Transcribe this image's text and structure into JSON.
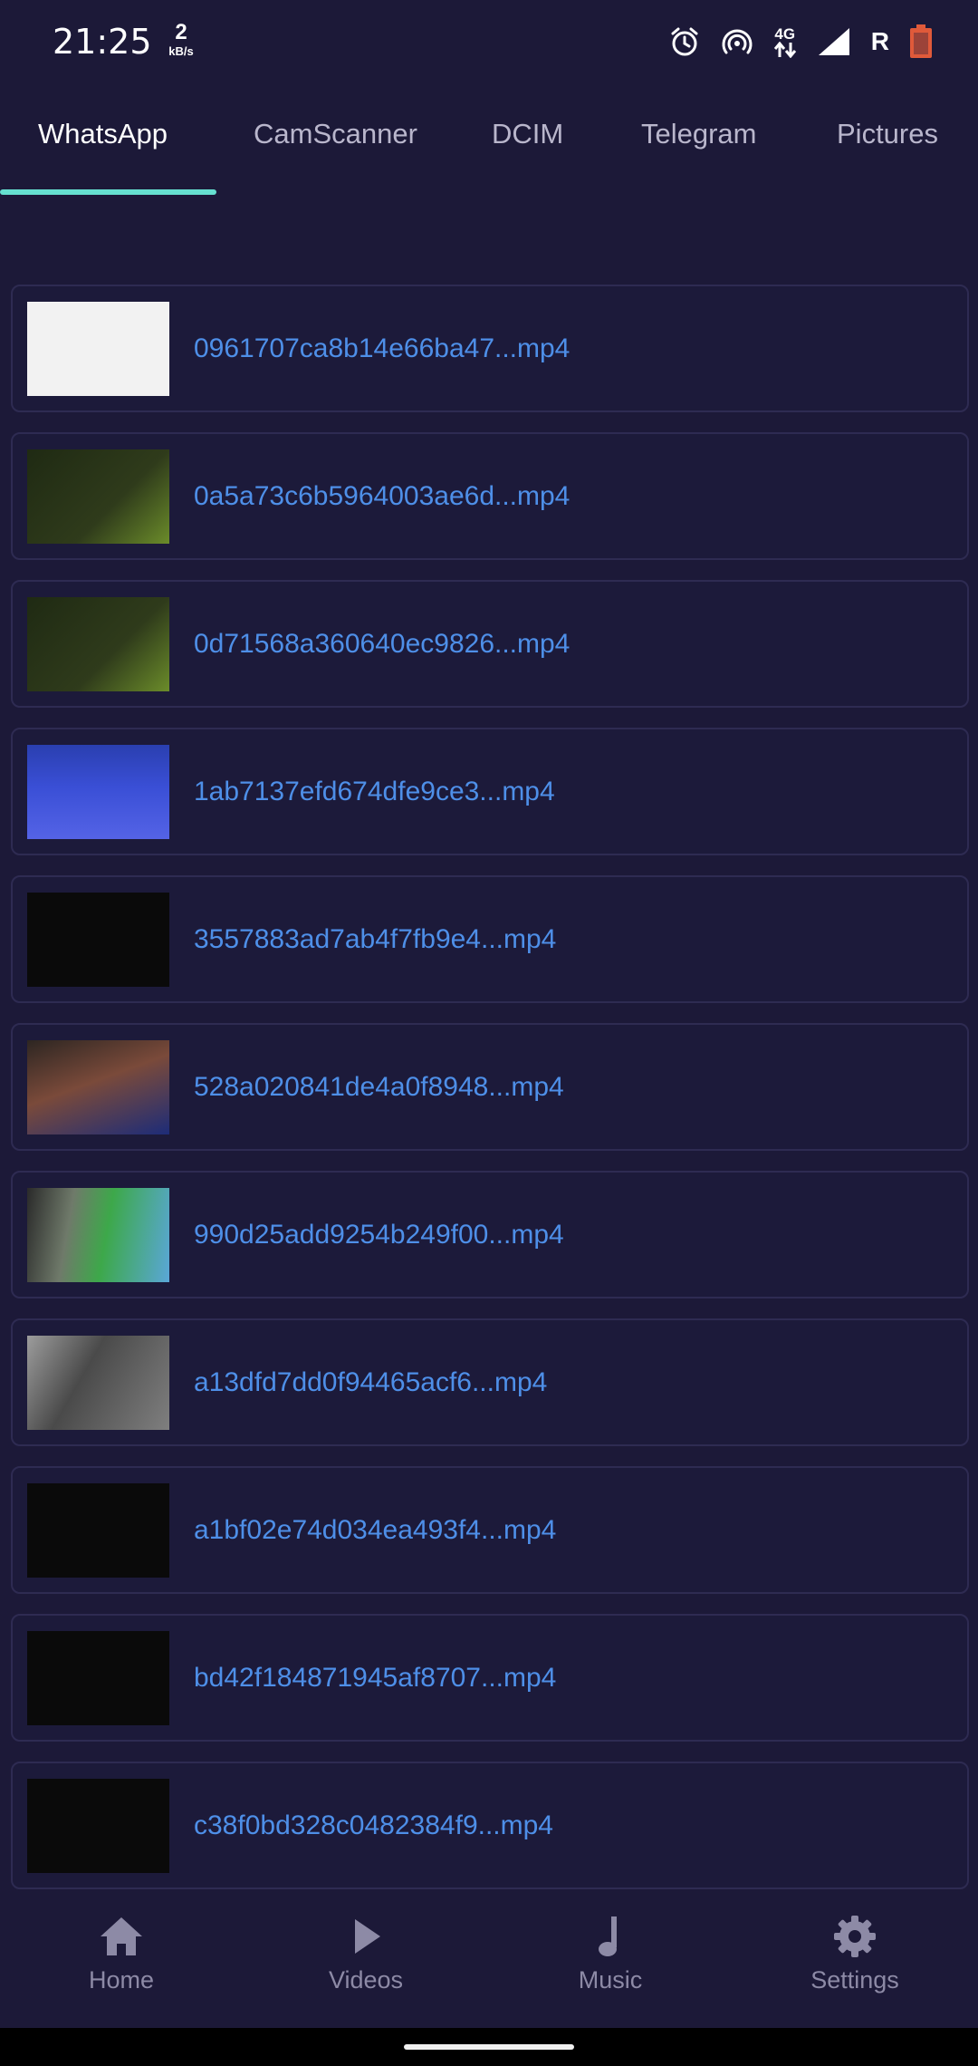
{
  "status_bar": {
    "time": "21:25",
    "net_speed_value": "2",
    "net_speed_unit": "kB/s",
    "network_type": "4G",
    "roaming": "R",
    "battery_level": "41",
    "icons": [
      "alarm-icon",
      "hotspot-icon",
      "data-arrows-icon",
      "signal-icon",
      "battery-icon"
    ]
  },
  "tabs": [
    {
      "label": "WhatsApp",
      "active": true
    },
    {
      "label": "CamScanner",
      "active": false
    },
    {
      "label": "DCIM",
      "active": false
    },
    {
      "label": "Telegram",
      "active": false
    },
    {
      "label": "Pictures",
      "active": false
    }
  ],
  "files": [
    {
      "name": "0961707ca8b14e66ba47...mp4"
    },
    {
      "name": "0a5a73c6b5964003ae6d...mp4"
    },
    {
      "name": "0d71568a360640ec9826...mp4"
    },
    {
      "name": "1ab7137efd674dfe9ce3...mp4"
    },
    {
      "name": "3557883ad7ab4f7fb9e4...mp4"
    },
    {
      "name": "528a020841de4a0f8948...mp4"
    },
    {
      "name": "990d25add9254b249f00...mp4"
    },
    {
      "name": "a13dfd7dd0f94465acf6...mp4"
    },
    {
      "name": "a1bf02e74d034ea493f4...mp4"
    },
    {
      "name": "bd42f184871945af8707...mp4"
    },
    {
      "name": "c38f0bd328c0482384f9...mp4"
    }
  ],
  "bottom_nav": [
    {
      "label": "Home",
      "icon": "home-icon"
    },
    {
      "label": "Videos",
      "icon": "play-icon"
    },
    {
      "label": "Music",
      "icon": "music-note-icon"
    },
    {
      "label": "Settings",
      "icon": "gear-icon"
    }
  ],
  "colors": {
    "background": "#1c1938",
    "accent": "#66e0d0",
    "file_name": "#4e8fe8",
    "nav_inactive": "#8d8aa6",
    "battery": "#e05a3a"
  }
}
